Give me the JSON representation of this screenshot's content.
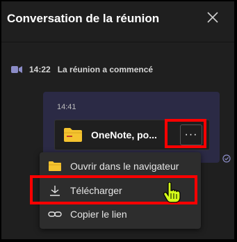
{
  "header": {
    "title": "Conversation de la réunion"
  },
  "event": {
    "time": "14:22",
    "text": "La réunion a commencé"
  },
  "message": {
    "time": "14:41",
    "file_name": "OneNote, po...",
    "more_label": "···"
  },
  "menu": {
    "items": [
      {
        "label": "Ouvrir dans le navigateur",
        "icon": "folder-icon"
      },
      {
        "label": "Télécharger",
        "icon": "download-icon"
      },
      {
        "label": "Copier le lien",
        "icon": "link-icon"
      }
    ]
  },
  "colors": {
    "background": "#1f1f1f",
    "bubble": "#2b2a45",
    "accent": "#8b8cc7",
    "highlight": "#ff0000",
    "folder": "#f4c32f"
  }
}
